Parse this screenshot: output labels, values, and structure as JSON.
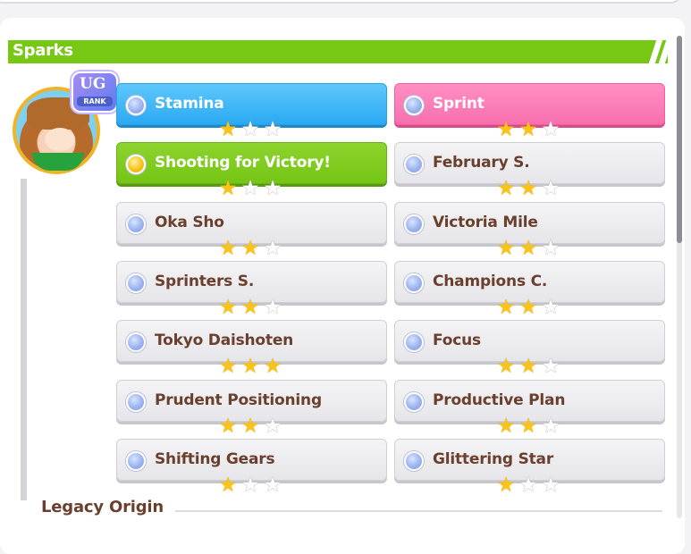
{
  "header": {
    "title": "Sparks"
  },
  "badge": {
    "top": "UG",
    "rank": "RANK"
  },
  "sparks": [
    {
      "label": "Stamina",
      "stars": 1,
      "style": "blue"
    },
    {
      "label": "Sprint",
      "stars": 2,
      "style": "pink"
    },
    {
      "label": "Shooting for Victory!",
      "stars": 1,
      "style": "green"
    },
    {
      "label": "February S.",
      "stars": 2,
      "style": "gray"
    },
    {
      "label": "Oka Sho",
      "stars": 2,
      "style": "gray"
    },
    {
      "label": "Victoria Mile",
      "stars": 2,
      "style": "gray"
    },
    {
      "label": "Sprinters S.",
      "stars": 2,
      "style": "gray"
    },
    {
      "label": "Champions C.",
      "stars": 2,
      "style": "gray"
    },
    {
      "label": "Tokyo Daishoten",
      "stars": 3,
      "style": "gray"
    },
    {
      "label": "Focus",
      "stars": 2,
      "style": "gray"
    },
    {
      "label": "Prudent Positioning",
      "stars": 2,
      "style": "gray"
    },
    {
      "label": "Productive Plan",
      "stars": 2,
      "style": "gray"
    },
    {
      "label": "Shifting Gears",
      "stars": 1,
      "style": "gray"
    },
    {
      "label": "Glittering Star",
      "stars": 1,
      "style": "gray"
    }
  ],
  "footer": {
    "title": "Legacy Origin"
  },
  "colors": {
    "header_green": "#77c715",
    "label_brown": "#6b3f2d",
    "star_gold": "#f9c419"
  }
}
